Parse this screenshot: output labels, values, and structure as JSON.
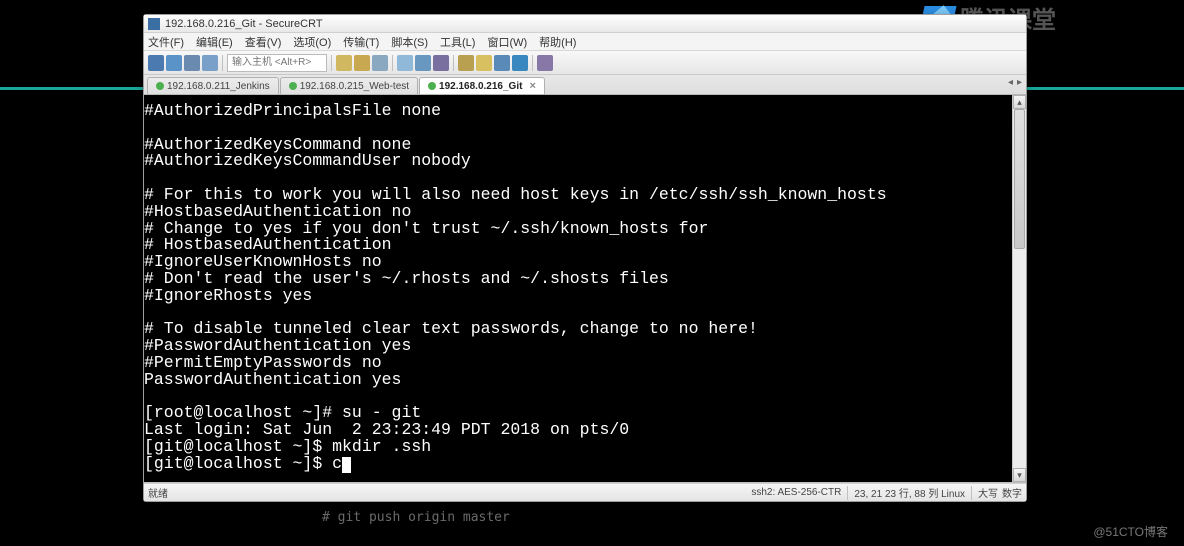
{
  "window": {
    "title": "192.168.0.216_Git - SecureCRT"
  },
  "menu": {
    "file": "文件(F)",
    "edit": "编辑(E)",
    "view": "查看(V)",
    "options": "选项(O)",
    "transfer": "传输(T)",
    "script": "脚本(S)",
    "tool": "工具(L)",
    "window": "窗口(W)",
    "help": "帮助(H)"
  },
  "toolbar": {
    "host_placeholder": "输入主机 <Alt+R>"
  },
  "tabs": [
    {
      "label": "192.168.0.211_Jenkins",
      "active": false,
      "close": false
    },
    {
      "label": "192.168.0.215_Web-test",
      "active": false,
      "close": false
    },
    {
      "label": "192.168.0.216_Git",
      "active": true,
      "close": true
    }
  ],
  "terminal": {
    "content": "#AuthorizedPrincipalsFile none\n\n#AuthorizedKeysCommand none\n#AuthorizedKeysCommandUser nobody\n\n# For this to work you will also need host keys in /etc/ssh/ssh_known_hosts\n#HostbasedAuthentication no\n# Change to yes if you don't trust ~/.ssh/known_hosts for\n# HostbasedAuthentication\n#IgnoreUserKnownHosts no\n# Don't read the user's ~/.rhosts and ~/.shosts files\n#IgnoreRhosts yes\n\n# To disable tunneled clear text passwords, change to no here!\n#PasswordAuthentication yes\n#PermitEmptyPasswords no\nPasswordAuthentication yes\n\n[root@localhost ~]# su - git\nLast login: Sat Jun  2 23:23:49 PDT 2018 on pts/0\n[git@localhost ~]$ mkdir .ssh\n[git@localhost ~]$ c"
  },
  "status": {
    "ready": "就绪",
    "cipher": "ssh2: AES-256-CTR",
    "pos": "23,  21   23 行, 88 列  Linux",
    "caps": "大写",
    "num": "数字"
  },
  "watermark": {
    "brand": "腾讯课堂",
    "bottom": "@51CTO博客"
  },
  "external": {
    "note": "# git push origin master"
  }
}
